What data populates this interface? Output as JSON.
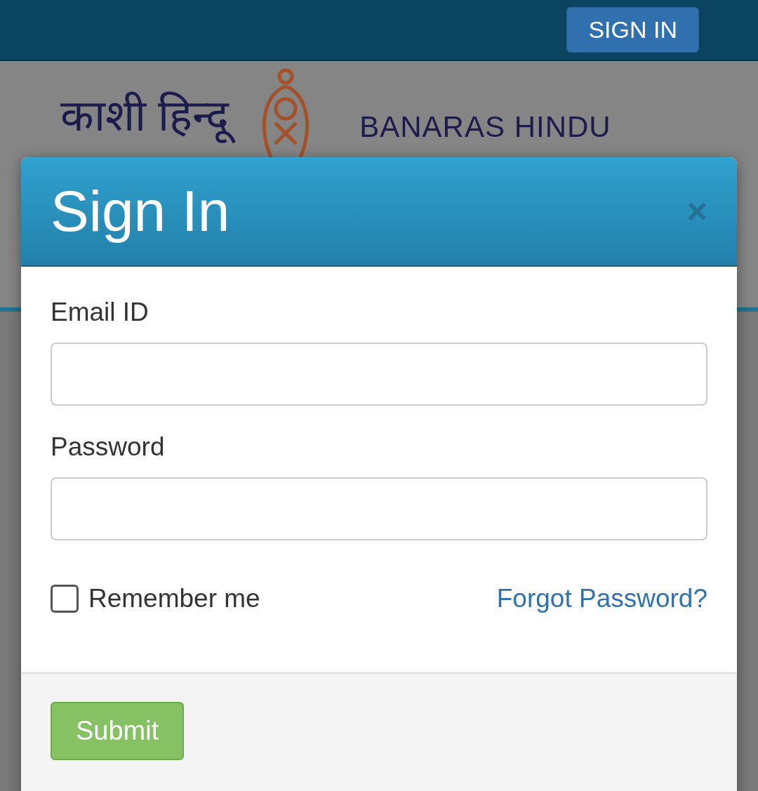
{
  "top_bar": {
    "sign_in_button": "SIGN IN"
  },
  "header": {
    "logo_hindi": "काशी हिन्दू",
    "logo_english": "BANARAS HINDU"
  },
  "modal": {
    "title": "Sign In",
    "close": "×",
    "fields": [
      {
        "label": "Email ID"
      },
      {
        "label": "Password"
      }
    ],
    "remember": {
      "label": "Remember me",
      "checked": false
    },
    "forgot_link": "Forgot Password?",
    "submit": "Submit"
  }
}
